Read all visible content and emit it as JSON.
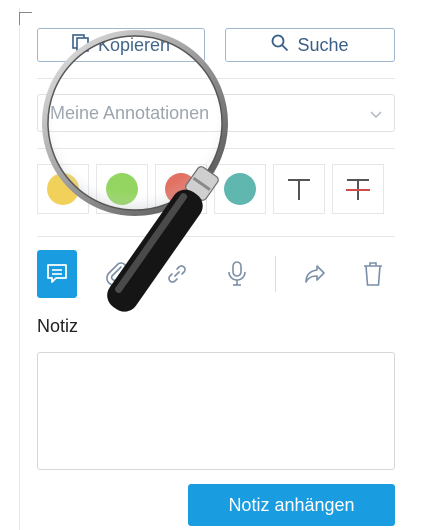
{
  "actions": {
    "copy_label": "Kopieren",
    "search_label": "Suche"
  },
  "filter": {
    "selected": "Meine Annotationen"
  },
  "colors": {
    "yellow": "#f2d15a",
    "green": "#8fd35a",
    "red": "#e06a5a",
    "teal": "#5fb7b0",
    "accent": "#1a9de0"
  },
  "note": {
    "label": "Notiz",
    "submit_label": "Notiz anhängen"
  }
}
